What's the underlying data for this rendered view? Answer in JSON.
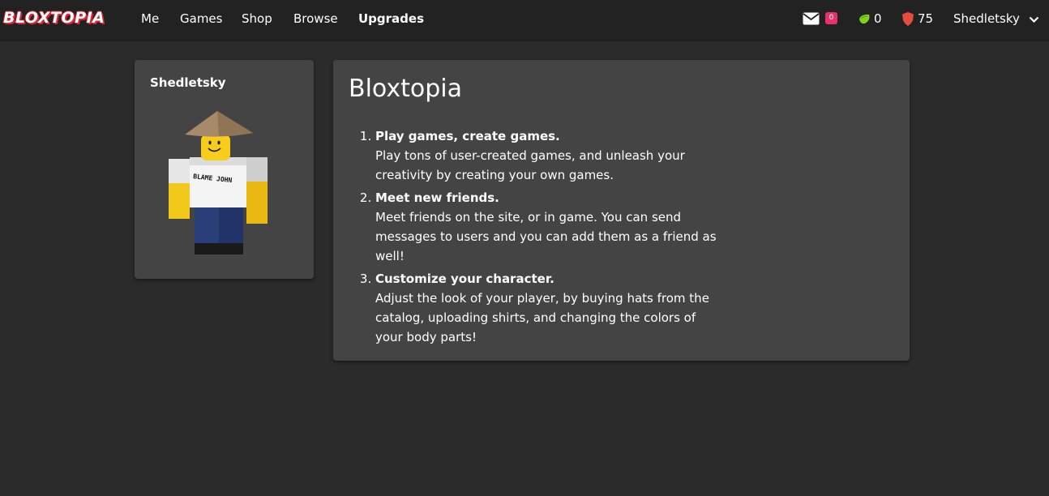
{
  "brand": {
    "logo_text": "BLOXTOPIA",
    "logo_outline_color": "#d72638"
  },
  "nav": {
    "me": "Me",
    "games": "Games",
    "shop": "Shop",
    "browse": "Browse",
    "upgrades": "Upgrades"
  },
  "header_right": {
    "mail_badge_count": "0",
    "green_currency": "0",
    "red_currency": "75",
    "username": "Shedletsky"
  },
  "profile": {
    "name": "Shedletsky",
    "shirt_text": "BLAME JOHN"
  },
  "info": {
    "title": "Bloxtopia",
    "items": [
      {
        "head": "Play games, create games.",
        "desc": "Play tons of user-created games, and unleash your creativity by creating your own games."
      },
      {
        "head": "Meet new friends.",
        "desc": "Meet friends on the site, or in game. You can send messages to users and you can add them as a friend as well!"
      },
      {
        "head": "Customize your character.",
        "desc": "Adjust the look of your player, by buying hats from the catalog, uploading shirts, and changing the colors of your body parts!"
      }
    ]
  },
  "colors": {
    "page_bg": "#2b2b2b",
    "topbar_bg": "#222222",
    "card_bg": "#444444",
    "mail_badge": "#e8316a",
    "green_gem": "#7ed321",
    "red_shield": "#e74c3c"
  },
  "icons": [
    "mail-icon",
    "green-gem-icon",
    "red-shield-icon",
    "chevron-down-icon"
  ]
}
